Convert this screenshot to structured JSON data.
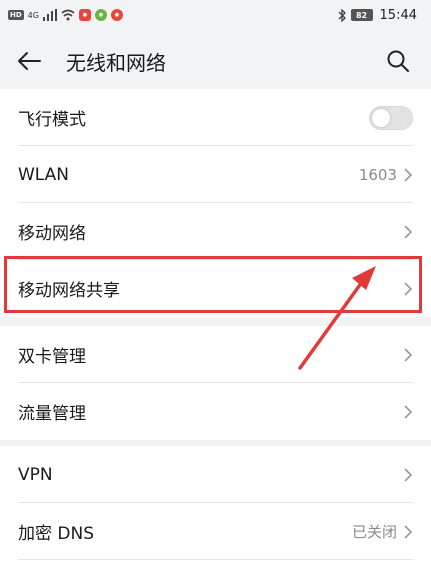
{
  "status_bar": {
    "hd": "HD",
    "network": "4G",
    "battery": "82",
    "time": "15:44"
  },
  "header": {
    "title": "无线和网络"
  },
  "section1": {
    "items": [
      {
        "label": "飞行模式",
        "toggle": false
      },
      {
        "label": "WLAN",
        "value": "1603"
      },
      {
        "label": "移动网络",
        "value": ""
      },
      {
        "label": "移动网络共享",
        "value": ""
      }
    ]
  },
  "section2": {
    "items": [
      {
        "label": "双卡管理",
        "value": ""
      },
      {
        "label": "流量管理",
        "value": ""
      }
    ]
  },
  "section3": {
    "items": [
      {
        "label": "VPN",
        "value": ""
      },
      {
        "label": "加密 DNS",
        "value": "已关闭"
      }
    ]
  },
  "colors": {
    "highlight": "#e23a3a",
    "background": "#f1f3f5",
    "card": "#ffffff"
  }
}
